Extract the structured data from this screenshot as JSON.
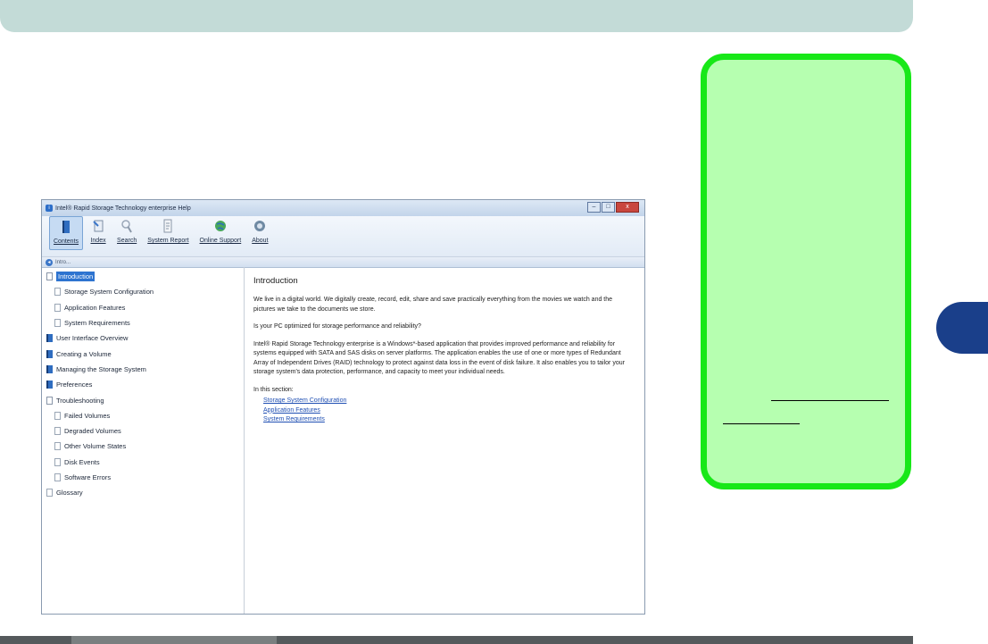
{
  "page": {
    "note_link_text": ""
  },
  "window": {
    "title": "Intel® Rapid Storage Technology enterprise Help",
    "buttons": {
      "minimize": "–",
      "maximize": "□",
      "close": "x"
    },
    "toolbar": [
      {
        "label": "Contents",
        "icon": "contents-book-icon",
        "selected": true
      },
      {
        "label": "Index",
        "icon": "index-icon",
        "selected": false
      },
      {
        "label": "Search",
        "icon": "search-icon",
        "selected": false
      },
      {
        "label": "System Report",
        "icon": "report-icon",
        "selected": false
      },
      {
        "label": "Online Support",
        "icon": "globe-icon",
        "selected": false
      },
      {
        "label": "About",
        "icon": "about-icon",
        "selected": false
      }
    ],
    "nav": {
      "crumb": "Intro..."
    },
    "tree": [
      {
        "label": "Introduction",
        "level": 0,
        "icon": "bookopen",
        "selected": true
      },
      {
        "label": "Storage System Configuration",
        "level": 1,
        "icon": "page"
      },
      {
        "label": "Application Features",
        "level": 1,
        "icon": "page"
      },
      {
        "label": "System Requirements",
        "level": 1,
        "icon": "page"
      },
      {
        "label": "User Interface Overview",
        "level": 0,
        "icon": "book"
      },
      {
        "label": "Creating a Volume",
        "level": 0,
        "icon": "book"
      },
      {
        "label": "Managing the Storage System",
        "level": 0,
        "icon": "book"
      },
      {
        "label": "Preferences",
        "level": 0,
        "icon": "book"
      },
      {
        "label": "Troubleshooting",
        "level": 0,
        "icon": "bookopen"
      },
      {
        "label": "Failed Volumes",
        "level": 1,
        "icon": "page"
      },
      {
        "label": "Degraded Volumes",
        "level": 1,
        "icon": "page"
      },
      {
        "label": "Other Volume States",
        "level": 1,
        "icon": "page"
      },
      {
        "label": "Disk Events",
        "level": 1,
        "icon": "page"
      },
      {
        "label": "Software Errors",
        "level": 1,
        "icon": "page"
      },
      {
        "label": "Glossary",
        "level": 0,
        "icon": "page"
      }
    ],
    "content": {
      "heading": "Introduction",
      "p1": "We live in a digital world. We digitally create, record, edit, share and save practically everything from the movies we watch and the pictures we take to the documents we store.",
      "p2": "Is your PC optimized for storage performance and reliability?",
      "p3": "Intel® Rapid Storage Technology enterprise is a Windows*-based application that provides improved performance and reliability for systems equipped with SATA and SAS disks on server platforms. The application enables the use of one or more types of Redundant Array of Independent Drives (RAID) technology to protect against data loss in the event of disk failure. It also enables you to tailor your storage system's data protection, performance, and capacity to meet your individual needs.",
      "in_section": "In this section:",
      "links": [
        "Storage System Configuration",
        "Application Features",
        "System Requirements"
      ]
    }
  },
  "colors": {
    "header_bar": "#c3dbd7",
    "note_fill": "#b6ffb0",
    "note_border": "#18e818",
    "chapter_tab": "#1a3f8a",
    "footer_bar": "#555a5c"
  }
}
